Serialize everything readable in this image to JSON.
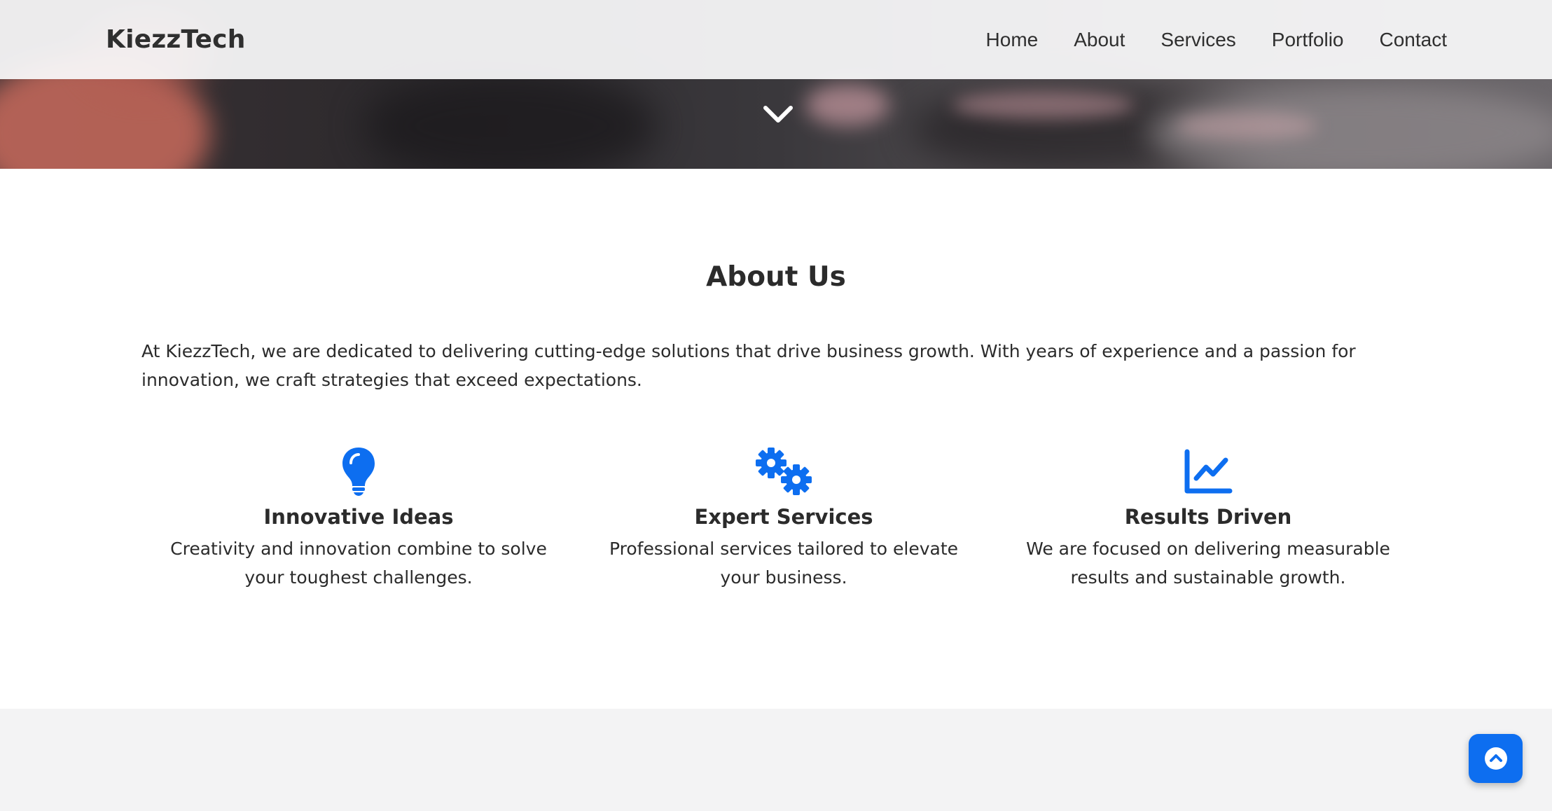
{
  "header": {
    "logo": "KiezzTech",
    "nav": [
      "Home",
      "About",
      "Services",
      "Portfolio",
      "Contact"
    ]
  },
  "hero": {
    "scroll_icon": "chevron-down-icon"
  },
  "about": {
    "title": "About Us",
    "text": "At KiezzTech, we are dedicated to delivering cutting-edge solutions that drive business growth. With years of experience and a passion for innovation, we craft strategies that exceed expectations.",
    "features": [
      {
        "icon": "lightbulb-icon",
        "title": "Innovative Ideas",
        "text": "Creativity and innovation combine to solve your toughest challenges."
      },
      {
        "icon": "gears-icon",
        "title": "Expert Services",
        "text": "Professional services tailored to elevate your business."
      },
      {
        "icon": "chart-line-icon",
        "title": "Results Driven",
        "text": "We are focused on delivering measurable results and sustainable growth."
      }
    ]
  },
  "back_to_top": {
    "icon": "chevron-up-circle-icon"
  },
  "colors": {
    "accent": "#0d6ef0",
    "text": "#2b2b2b",
    "header_bg": "#fafafb",
    "section_alt_bg": "#f3f3f4"
  }
}
